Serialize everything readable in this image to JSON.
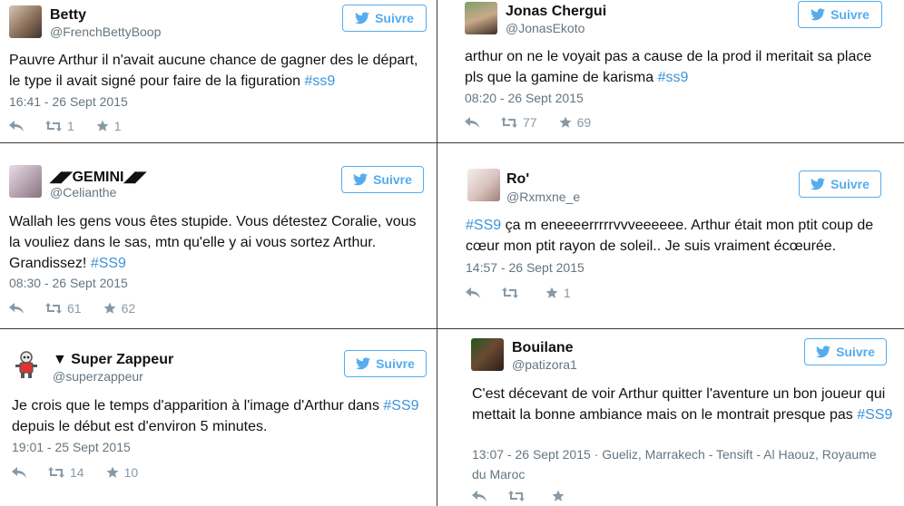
{
  "follow_label": "Suivre",
  "tweets": [
    {
      "name": "Betty",
      "handle": "@FrenchBettyBoop",
      "text_before": "Pauvre Arthur il n'avait aucune chance de gagner des le départ, le type il avait signé pour faire de la figuration ",
      "hashtag": "#ss9",
      "text_after": "",
      "time": "16:41 - 26 Sept 2015",
      "retweets": "1",
      "favorites": "1"
    },
    {
      "name": "Jonas Chergui",
      "handle": "@JonasEkoto",
      "text_before": "arthur on ne le voyait pas a cause de la prod il meritait sa place pls que la gamine de karisma ",
      "hashtag": "#ss9",
      "text_after": "",
      "time": "08:20 - 26 Sept 2015",
      "retweets": "77",
      "favorites": "69"
    },
    {
      "name": "◢◤GEMINI◢◤",
      "handle": "@Celianthe",
      "text_before": "Wallah les gens vous êtes stupide. Vous détestez Coralie, vous la vouliez dans le sas, mtn qu'elle y ai vous sortez Arthur. Grandissez! ",
      "hashtag": "#SS9",
      "text_after": "",
      "time": "08:30 - 26 Sept 2015",
      "retweets": "61",
      "favorites": "62"
    },
    {
      "name": "Ro'",
      "handle": "@Rxmxne_e",
      "text_before": "",
      "hashtag": "#SS9",
      "text_after": " ça m eneeeerrrrrvvveeeeee. Arthur était mon ptit coup de cœur mon ptit rayon de soleil.. Je suis vraiment écœurée.",
      "time": "14:57 - 26 Sept 2015",
      "retweets": "",
      "favorites": "1"
    },
    {
      "name": "▼ Super Zappeur",
      "handle": "@superzappeur",
      "text_before": "Je crois que le temps d'apparition à l'image d'Arthur dans ",
      "hashtag": "#SS9",
      "text_after": " depuis le début est d'environ 5 minutes.",
      "time": "19:01 - 25 Sept 2015",
      "retweets": "14",
      "favorites": "10"
    },
    {
      "name": "Bouilane",
      "handle": "@patizora1",
      "text_before": "C'est décevant de voir Arthur quitter l'aventure un bon joueur qui mettait la bonne ambiance mais on le montrait presque pas ",
      "hashtag": "#SS9",
      "text_after": "",
      "time": "13:07 - 26 Sept 2015",
      "location": " · Gueliz, Marrakech - Tensift - Al Haouz, Royaume du Maroc",
      "retweets": "",
      "favorites": ""
    }
  ]
}
